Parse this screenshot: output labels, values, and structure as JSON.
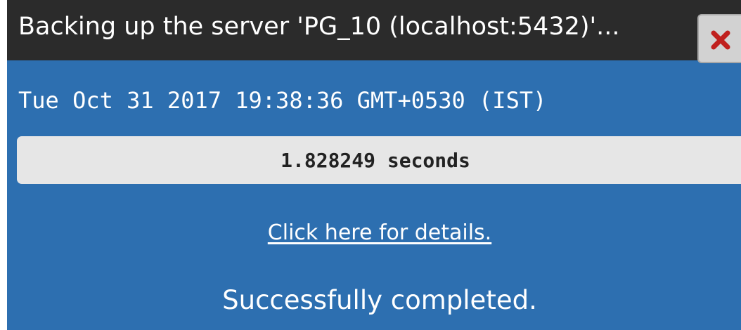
{
  "dialog": {
    "title": "Backing up the server 'PG_10 (localhost:5432)'...",
    "close_icon": "close-x-icon",
    "timestamp": "Tue Oct 31 2017 19:38:36 GMT+0530 (IST)",
    "duration": "1.828249 seconds",
    "details_link": "Click here for details.",
    "status": "Successfully completed."
  },
  "colors": {
    "panel_background": "#2d6fb0",
    "titlebar_background": "#2b2b2b",
    "duration_background": "#e6e6e6",
    "close_icon": "#c0201e"
  }
}
